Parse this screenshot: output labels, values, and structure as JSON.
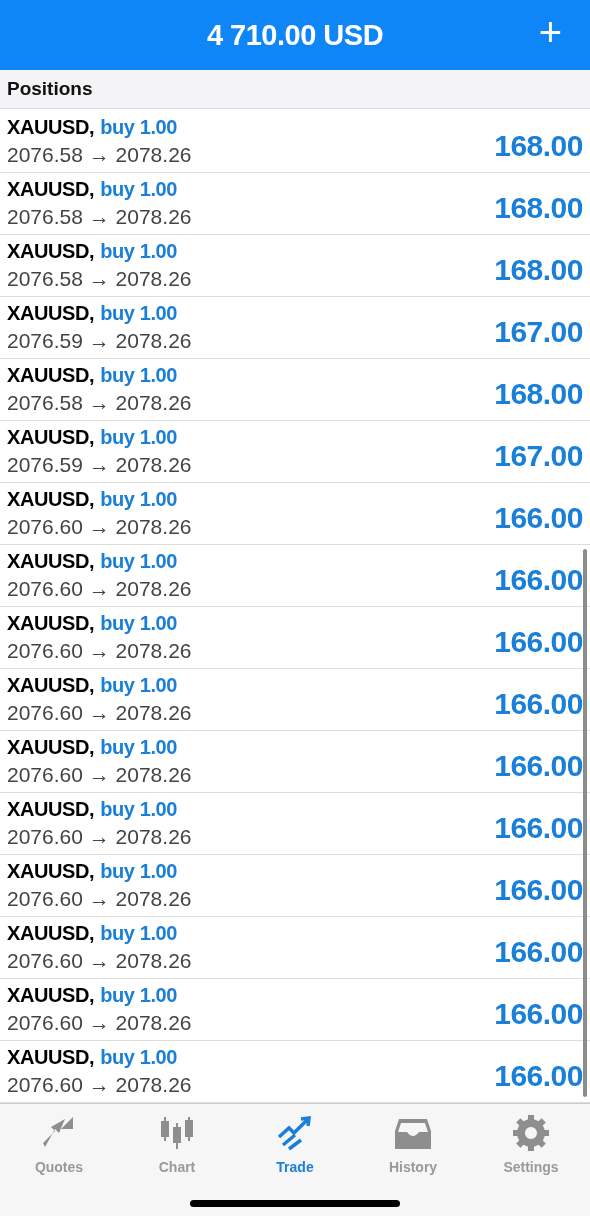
{
  "header": {
    "balance": "4 710.00 USD",
    "add_button": "+"
  },
  "section_title": "Positions",
  "positions": [
    {
      "symbol": "XAUUSD,",
      "order": "buy 1.00",
      "prices": "2076.58 → 2078.26",
      "profit": "168.00"
    },
    {
      "symbol": "XAUUSD,",
      "order": "buy 1.00",
      "prices": "2076.58 → 2078.26",
      "profit": "168.00"
    },
    {
      "symbol": "XAUUSD,",
      "order": "buy 1.00",
      "prices": "2076.58 → 2078.26",
      "profit": "168.00"
    },
    {
      "symbol": "XAUUSD,",
      "order": "buy 1.00",
      "prices": "2076.59 → 2078.26",
      "profit": "167.00"
    },
    {
      "symbol": "XAUUSD,",
      "order": "buy 1.00",
      "prices": "2076.58 → 2078.26",
      "profit": "168.00"
    },
    {
      "symbol": "XAUUSD,",
      "order": "buy 1.00",
      "prices": "2076.59 → 2078.26",
      "profit": "167.00"
    },
    {
      "symbol": "XAUUSD,",
      "order": "buy 1.00",
      "prices": "2076.60 → 2078.26",
      "profit": "166.00"
    },
    {
      "symbol": "XAUUSD,",
      "order": "buy 1.00",
      "prices": "2076.60 → 2078.26",
      "profit": "166.00"
    },
    {
      "symbol": "XAUUSD,",
      "order": "buy 1.00",
      "prices": "2076.60 → 2078.26",
      "profit": "166.00"
    },
    {
      "symbol": "XAUUSD,",
      "order": "buy 1.00",
      "prices": "2076.60 → 2078.26",
      "profit": "166.00"
    },
    {
      "symbol": "XAUUSD,",
      "order": "buy 1.00",
      "prices": "2076.60 → 2078.26",
      "profit": "166.00"
    },
    {
      "symbol": "XAUUSD,",
      "order": "buy 1.00",
      "prices": "2076.60 → 2078.26",
      "profit": "166.00"
    },
    {
      "symbol": "XAUUSD,",
      "order": "buy 1.00",
      "prices": "2076.60 → 2078.26",
      "profit": "166.00"
    },
    {
      "symbol": "XAUUSD,",
      "order": "buy 1.00",
      "prices": "2076.60 → 2078.26",
      "profit": "166.00"
    },
    {
      "symbol": "XAUUSD,",
      "order": "buy 1.00",
      "prices": "2076.60 → 2078.26",
      "profit": "166.00"
    },
    {
      "symbol": "XAUUSD,",
      "order": "buy 1.00",
      "prices": "2076.60 → 2078.26",
      "profit": "166.00"
    }
  ],
  "tabs": [
    {
      "kind": "quotes",
      "label": "Quotes",
      "selected": false
    },
    {
      "kind": "chart",
      "label": "Chart",
      "selected": false
    },
    {
      "kind": "trade",
      "label": "Trade",
      "selected": true
    },
    {
      "kind": "history",
      "label": "History",
      "selected": false
    },
    {
      "kind": "settings",
      "label": "Settings",
      "selected": false
    }
  ]
}
